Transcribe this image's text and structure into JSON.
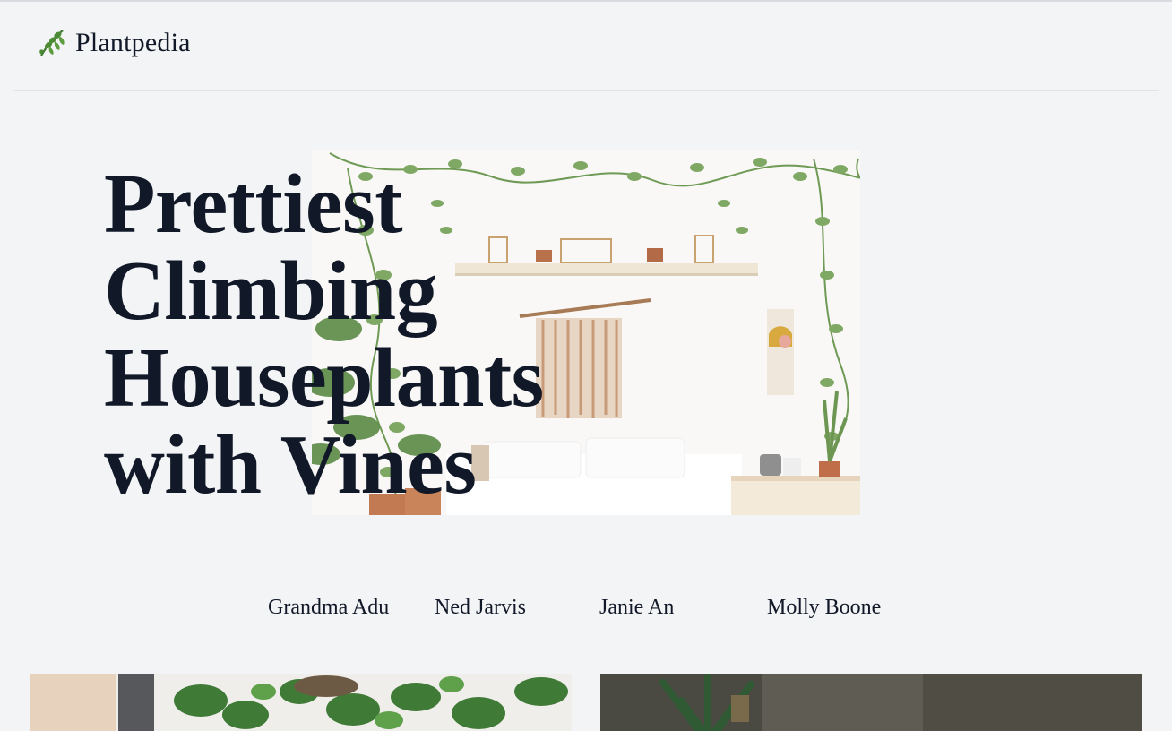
{
  "header": {
    "brand_name": "Plantpedia",
    "brand_icon": "leaf-icon"
  },
  "hero": {
    "title_lines": [
      "Prettiest",
      "Climbing",
      "Houseplants",
      "with Vines"
    ],
    "image": "bedroom-with-climbing-plants-photo"
  },
  "authors": [
    "Grandma Adu",
    "Ned Jarvis",
    "Janie An",
    "Molly Boone"
  ],
  "cards": [
    {
      "image": "monstera-houseplants-photo"
    },
    {
      "image": "succulent-aloe-photo"
    }
  ],
  "colors": {
    "background": "#f3f4f6",
    "text": "#111827",
    "leaf_green": "#3f7a2e"
  }
}
